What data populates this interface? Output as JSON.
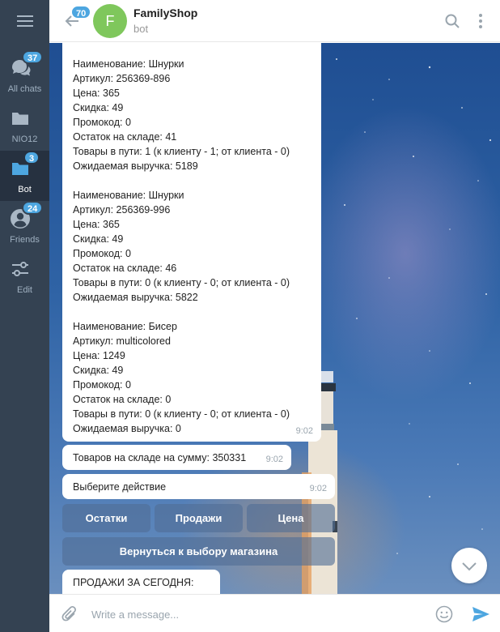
{
  "sidebar": {
    "folders": [
      {
        "label": "All chats",
        "badge": "37",
        "icon": "chats-icon"
      },
      {
        "label": "NIO12",
        "badge": "",
        "icon": "folder-icon"
      },
      {
        "label": "Bot",
        "badge": "3",
        "icon": "folder-icon",
        "active": true
      },
      {
        "label": "Friends",
        "badge": "24",
        "icon": "person-icon"
      },
      {
        "label": "Edit",
        "badge": "",
        "icon": "sliders-icon"
      }
    ]
  },
  "header": {
    "unread": "70",
    "avatar_letter": "F",
    "title": "FamilyShop",
    "subtitle": "bot"
  },
  "messages": {
    "products": [
      [
        "Наименование: Шнурки",
        "Артикул: 256369-896",
        "Цена: 365",
        "Скидка: 49",
        "Промокод: 0",
        "Остаток на складе: 41",
        "Товары в пути: 1 (к клиенту - 1; от клиента - 0)",
        "Ожидаемая выручка: 5189"
      ],
      [
        "Наименование: Шнурки",
        "Артикул: 256369-996",
        "Цена: 365",
        "Скидка: 49",
        "Промокод: 0",
        "Остаток на складе: 46",
        "Товары в пути: 0 (к клиенту - 0; от клиента - 0)",
        "Ожидаемая выручка: 5822"
      ],
      [
        "Наименование: Бисер",
        "Артикул: multicolored",
        "Цена: 1249",
        "Скидка: 49",
        "Промокод: 0",
        "Остаток на складе: 0",
        "Товары в пути: 0 (к клиенту - 0; от клиента - 0)",
        "Ожидаемая выручка: 0"
      ]
    ],
    "products_time": "9:02",
    "total": {
      "text": "Товаров на складе на сумму: 350331",
      "time": "9:02"
    },
    "choose": {
      "text": "Выберите действие",
      "time": "9:02"
    },
    "sales_today": "ПРОДАЖИ ЗА СЕГОДНЯ:"
  },
  "keyboard": {
    "stock": "Остатки",
    "sales": "Продажи",
    "price": "Цена",
    "back": "Вернуться к выбору магазина"
  },
  "composer": {
    "placeholder": "Write a message..."
  },
  "colors": {
    "sidebar_bg": "#344252",
    "sidebar_active": "#263140",
    "accent": "#4da6e0",
    "avatar": "#7fc75c"
  }
}
